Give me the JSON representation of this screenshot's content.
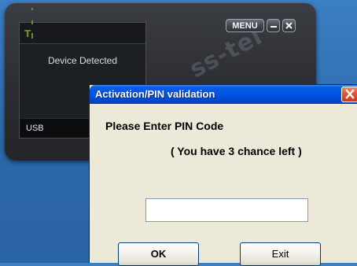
{
  "widget": {
    "watermark": "ss-tel",
    "status_text": "Device Detected",
    "connection_label": "USB",
    "menu_label": "MENU",
    "signal_icon": "signal-icon",
    "minimize_icon": "minimize-icon",
    "close_icon": "close-icon"
  },
  "dialog": {
    "title": "Activation/PIN validation",
    "close_icon": "close-icon",
    "prompt": "Please Enter PIN Code",
    "chances_text": "( You have 3 chance left )",
    "pin_value": "",
    "ok_label": "OK",
    "exit_label": "Exit"
  },
  "colors": {
    "desktop": "#2c68aa",
    "widget_body": "#2a2c31",
    "titlebar": "#0054e3",
    "close_button": "#e05a36",
    "dialog_face": "#ece9d8",
    "signal": "#6b8f2a"
  }
}
